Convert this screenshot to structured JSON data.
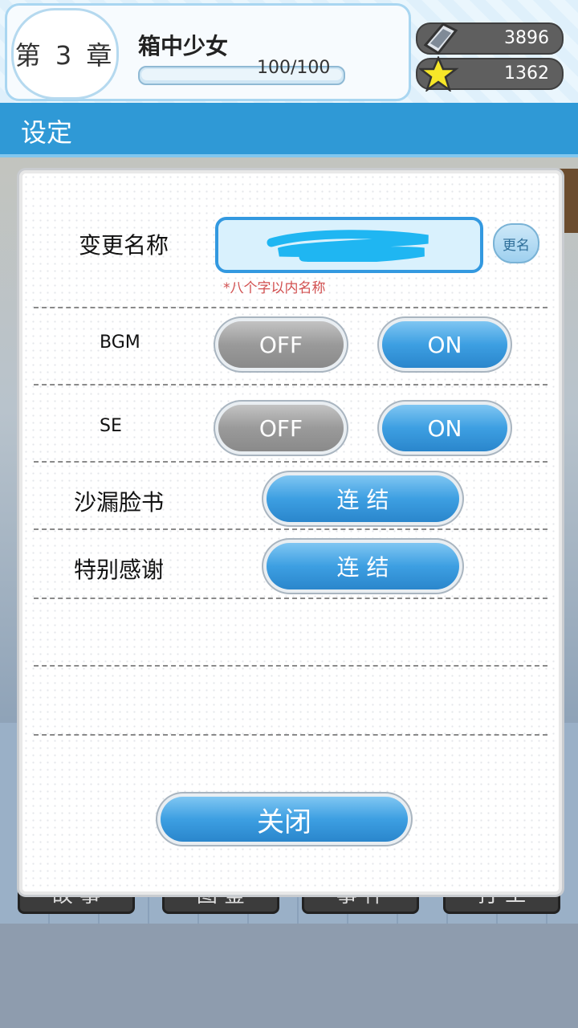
{
  "header": {
    "chapter": "第 3 章",
    "chapter_title": "箱中少女",
    "progress_text": "100/100",
    "progress": 1.0,
    "currency": [
      {
        "icon": "card-icon",
        "value": "3896"
      },
      {
        "icon": "star-icon",
        "value": "1362"
      }
    ]
  },
  "titlebar": {
    "title": "设定"
  },
  "settings": {
    "rename_label": "变更名称",
    "rename_button": "更名",
    "rename_hint": "*八个字以内名称",
    "bgm_label": "BGM",
    "se_label": "SE",
    "off_label": "OFF",
    "on_label": "ON",
    "facebook_label": "沙漏脸书",
    "thanks_label": "特别感谢",
    "link_label": "连 结",
    "close_label": "关闭"
  },
  "background_tabs": [
    "故 事",
    "图 鉴",
    "事 件",
    "打 工"
  ],
  "colors": {
    "accent": "#2f99d6",
    "on": "#3d9fe2",
    "off": "#9a9a9a",
    "hint": "#d25050"
  }
}
